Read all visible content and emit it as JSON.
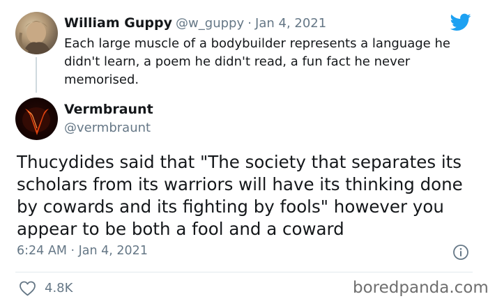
{
  "quoted_tweet": {
    "author_name": "William Guppy",
    "handle": "@w_guppy",
    "separator": "·",
    "date": "Jan 4, 2021",
    "text": "Each large muscle of a bodybuilder represents a language he didn't learn, a poem he didn't read, a fun fact he never memorised."
  },
  "reply_tweet": {
    "author_name": "Vermbraunt",
    "handle": "@vermbraunt",
    "text": "Thucydides said that \"The society that separates its scholars from its warriors will have its thinking done by cowards and its fighting by fools\" however you appear to be both a fool and a coward",
    "timestamp": "6:24 AM · Jan 4, 2021",
    "likes": "4.8K"
  },
  "watermark": "boredpanda.com",
  "icons": {
    "brand": "twitter-bird-icon",
    "info": "info-icon",
    "like": "heart-icon"
  },
  "colors": {
    "twitter_blue": "#1da1f2",
    "secondary_text": "#657786",
    "primary_text": "#14171a",
    "vermbraunt_red": "#e0420f"
  }
}
